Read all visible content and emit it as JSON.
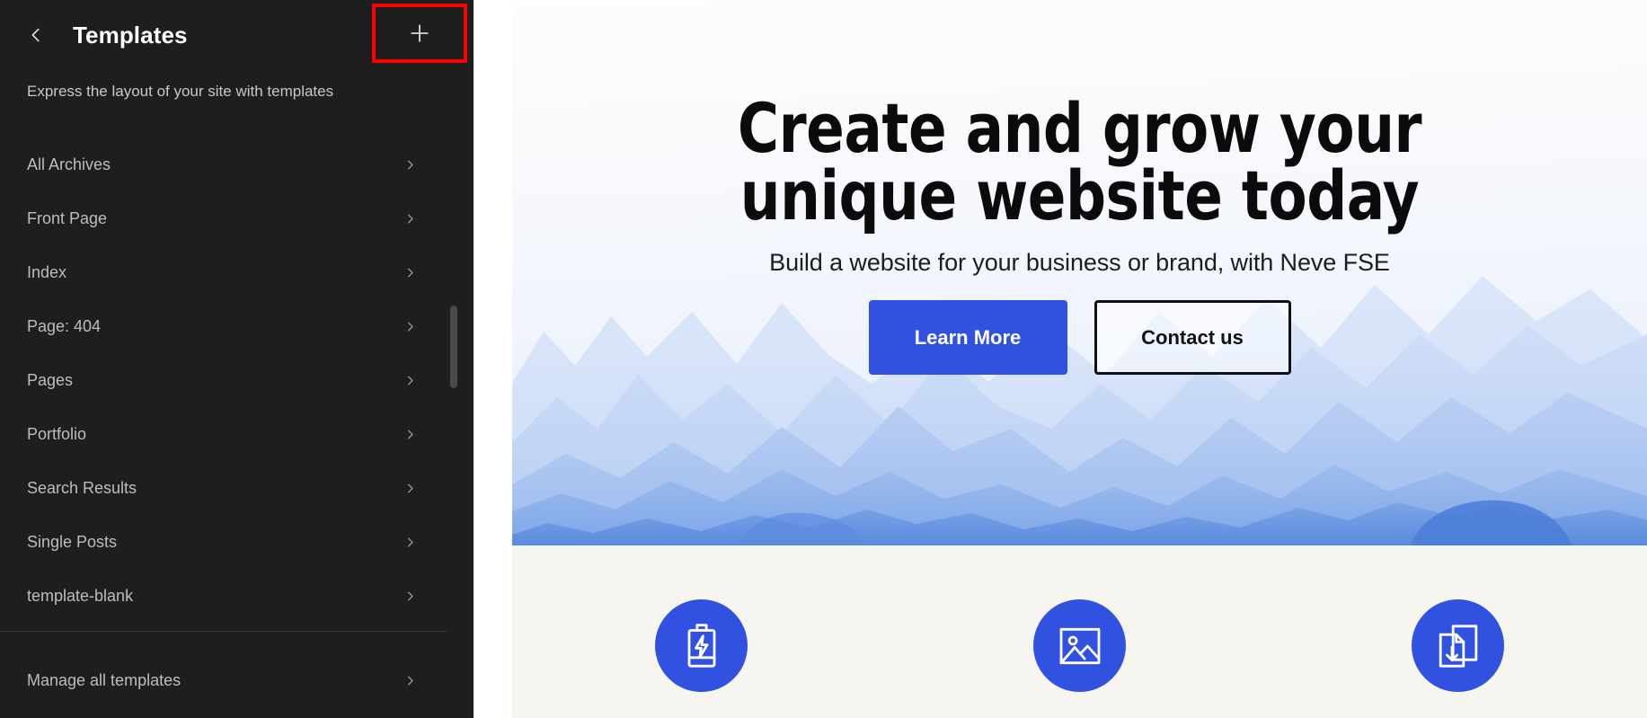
{
  "sidebar": {
    "back_icon": "chevron-left-icon",
    "title": "Templates",
    "add_icon": "plus-icon",
    "add_label": "+",
    "description": "Express the layout of your site with templates",
    "items": [
      {
        "label": "All Archives",
        "chevron": "chevron-right-icon"
      },
      {
        "label": "Front Page",
        "chevron": "chevron-right-icon"
      },
      {
        "label": "Index",
        "chevron": "chevron-right-icon"
      },
      {
        "label": "Page: 404",
        "chevron": "chevron-right-icon"
      },
      {
        "label": "Pages",
        "chevron": "chevron-right-icon"
      },
      {
        "label": "Portfolio",
        "chevron": "chevron-right-icon"
      },
      {
        "label": "Search Results",
        "chevron": "chevron-right-icon"
      },
      {
        "label": "Single Posts",
        "chevron": "chevron-right-icon"
      },
      {
        "label": "template-blank",
        "chevron": "chevron-right-icon"
      }
    ],
    "footer_item": {
      "label": "Manage all templates",
      "chevron": "chevron-right-icon"
    }
  },
  "preview": {
    "hero": {
      "heading_line1": "Create and grow your",
      "heading_line2": "unique website today",
      "subheading": "Build a website for your business or brand, with Neve FSE",
      "primary_button": "Learn More",
      "secondary_button": "Contact us"
    },
    "features": [
      {
        "icon": "battery-charging-icon"
      },
      {
        "icon": "image-icon"
      },
      {
        "icon": "document-download-icon"
      }
    ]
  },
  "colors": {
    "sidebar_bg": "#1e1e1e",
    "accent_blue": "#3151e0",
    "highlight_red": "#ff0000",
    "features_bg": "#f6f5f0"
  }
}
